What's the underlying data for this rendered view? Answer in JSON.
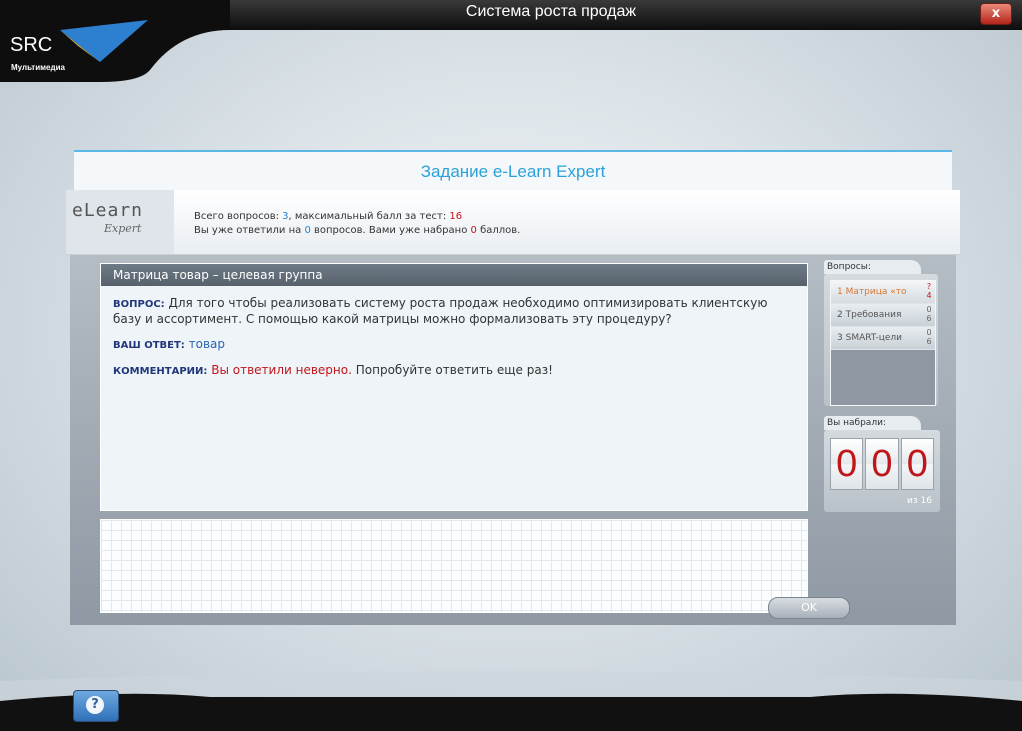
{
  "window": {
    "title": "Система роста продаж",
    "close_label": "x"
  },
  "brand": {
    "name": "SRC",
    "sub": "Мультимедиа"
  },
  "task": {
    "title": "Задание e-Learn Expert"
  },
  "logo": {
    "line1": "eLearn",
    "line2": "Expert"
  },
  "info": {
    "total_label": "Всего вопросов:",
    "total": "3",
    "max_label": ", максимальный балл за тест:",
    "max": "16",
    "answered_label": "Вы уже ответили на",
    "answered": "0",
    "answered_suffix": "вопросов. Вами уже набрано",
    "scored": "0",
    "scored_suffix": "баллов."
  },
  "question": {
    "header": "Матрица товар – целевая группа",
    "q_label": "ВОПРОС:",
    "q_text": "Для того чтобы реализовать систему роста продаж необходимо оптимизировать клиентскую базу и ассортимент. С помощью какой матрицы можно формализовать эту процедуру?",
    "a_label": "ВАШ ОТВЕТ:",
    "a_text": "товар",
    "c_label": "КОММЕНТАРИИ:",
    "c_wrong": "Вы ответили неверно.",
    "c_text": "Попробуйте ответить еще раз!"
  },
  "buttons": {
    "ok": "OK",
    "help": "?"
  },
  "questions_panel": {
    "label": "Вопросы:",
    "items": [
      {
        "num": "1",
        "label": "Матрица «то",
        "score_top": "?",
        "score_bottom": "4"
      },
      {
        "num": "2",
        "label": "Требования",
        "score_top": "0",
        "score_bottom": "6"
      },
      {
        "num": "3",
        "label": "SMART-цели",
        "score_top": "0",
        "score_bottom": "6"
      }
    ]
  },
  "score": {
    "label": "Вы набрали:",
    "digits": [
      "0",
      "0",
      "0"
    ],
    "out_of": "из 16"
  },
  "colors": {
    "accent": "#2aa1da",
    "error": "#c0151a",
    "answer": "#2a62b8"
  }
}
